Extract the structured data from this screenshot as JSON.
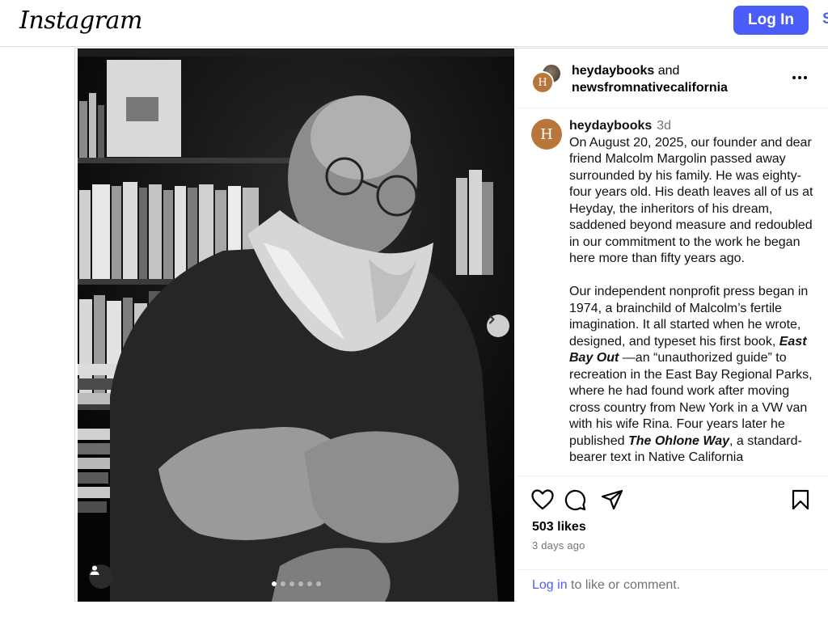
{
  "nav": {
    "logo": "Instagram",
    "login_label": "Log In",
    "signup_peek": "S"
  },
  "post": {
    "header": {
      "user1": "heydaybooks",
      "joiner": "and",
      "user2": "newsfromnativecalifornia",
      "avatar_letter": "H"
    },
    "caption": {
      "username": "heydaybooks",
      "time": "3d",
      "para1": "On August 20, 2025, our founder and dear friend Malcolm Margolin passed away surrounded by his family. He was eighty-four years old. His death leaves all of us at Heyday, the inheritors of his dream, saddened beyond measure and redoubled in our commitment to the work he began here more than fifty years ago.",
      "para2_a": "Our independent nonprofit press began in 1974, a brainchild of Malcolm’s fertile imagination. It all started when he wrote, designed, and typeset his first book, ",
      "book1": "East Bay Out",
      "para2_b": " —an “unauthorized guide” to recreation in the East Bay Regional Parks, where he had found work after moving cross country from New York in a VW van with his wife Rina. Four years later he published ",
      "book2": "The Ohlone Way",
      "para2_c": ", a standard-bearer text in Native California"
    },
    "likes": "503 likes",
    "time_ago": "3 days ago",
    "login_prompt": {
      "link": "Log in",
      "rest": " to like or comment."
    },
    "carousel": {
      "count": 6,
      "active_index": 0
    }
  },
  "icons": {
    "like": "heart-icon",
    "comment": "comment-icon",
    "share": "send-icon",
    "save": "bookmark-icon",
    "more": "more-options-icon",
    "next": "chevron-right-icon",
    "tag": "user-tag-icon"
  },
  "colors": {
    "accent": "#4a5df9",
    "avatar": "#b8763a",
    "muted": "#737373"
  }
}
